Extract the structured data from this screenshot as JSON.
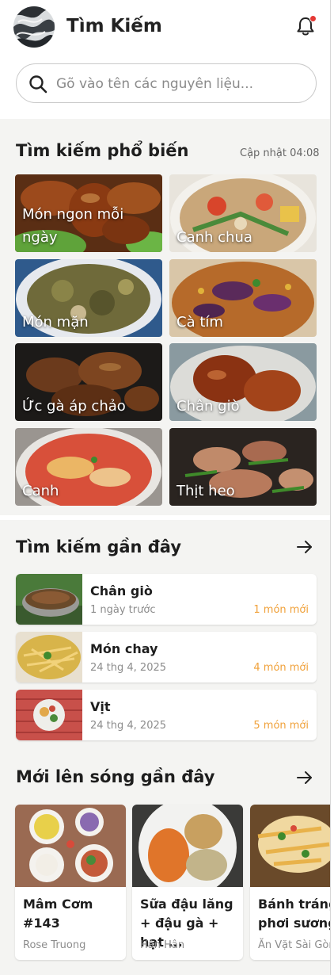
{
  "header": {
    "title": "Tìm Kiếm",
    "avatar_icon": "wave-avatar-icon",
    "notification_icon": "bell-icon",
    "has_notification": true
  },
  "search": {
    "placeholder": "Gõ vào tên các nguyên liệu...",
    "icon": "search-icon"
  },
  "popular": {
    "title": "Tìm kiếm phổ biến",
    "updated": "Cập nhật 04:08",
    "items": [
      {
        "label": "Món ngon mỗi ngày"
      },
      {
        "label": "Canh chua"
      },
      {
        "label": "Món mặn"
      },
      {
        "label": "Cà tím"
      },
      {
        "label": "Ức gà áp chảo"
      },
      {
        "label": "Chân giò"
      },
      {
        "label": "Canh"
      },
      {
        "label": "Thịt heo"
      }
    ]
  },
  "recent": {
    "title": "Tìm kiếm gần đây",
    "arrow_icon": "arrow-right-icon",
    "items": [
      {
        "name": "Chân giò",
        "date": "1 ngày trước",
        "new": "1 món mới"
      },
      {
        "name": "Món chay",
        "date": "24 thg 4, 2025",
        "new": "4 món mới"
      },
      {
        "name": "Vịt",
        "date": "24 thg 4, 2025",
        "new": "5 món mới"
      }
    ]
  },
  "new_recipes": {
    "title": "Mới lên sóng gần đây",
    "arrow_icon": "arrow-right-icon",
    "items": [
      {
        "title": "Mâm Cơm #143",
        "author": "Rose Truong"
      },
      {
        "title": "Sữa đậu lăng + đậu gà + hạt ...",
        "author": "Hân Hân"
      },
      {
        "title": "Bánh tráng phơi sương",
        "author": "Ăn Vặt Sài Gòn"
      }
    ]
  },
  "colors": {
    "accent_orange": "#f0a13a",
    "notification_red": "#e53935",
    "band_grey": "#f4f4f2"
  }
}
